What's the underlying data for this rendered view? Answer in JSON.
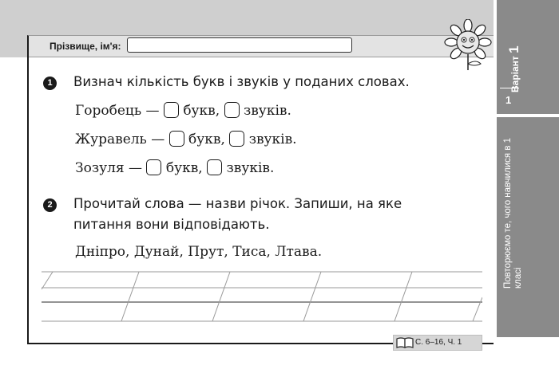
{
  "header": {
    "name_label": "Прізвище, ім'я:",
    "name_value": ""
  },
  "sidebar": {
    "variant_word": "Варіант",
    "variant_big": "1",
    "variant_number": "1",
    "topic": "Повторюємо те, чого навчилися в 1 класі"
  },
  "tasks": [
    {
      "number": "1",
      "instruction": "Визнач кількість букв і звуків у поданих словах.",
      "items": [
        {
          "word": "Горобець —",
          "letters_label": "букв,",
          "sounds_label": "звуків."
        },
        {
          "word": "Журавель —",
          "letters_label": "букв,",
          "sounds_label": "звуків."
        },
        {
          "word": "Зозуля —",
          "letters_label": "букв,",
          "sounds_label": "звуків."
        }
      ]
    },
    {
      "number": "2",
      "instruction_line1": "Прочитай слова — назви річок. Запиши, на яке",
      "instruction_line2": "питання вони відповідають.",
      "words": "Дніпро, Дунай, Прут, Тиса, Лтава."
    }
  ],
  "footer": {
    "page_ref": "С. 6–16, Ч. 1"
  },
  "icons": {
    "book": "book-icon",
    "mascot": "sunflower-mascot-icon"
  },
  "colors": {
    "sidebar": "#8a8a8a",
    "band": "#cfcfcf"
  }
}
